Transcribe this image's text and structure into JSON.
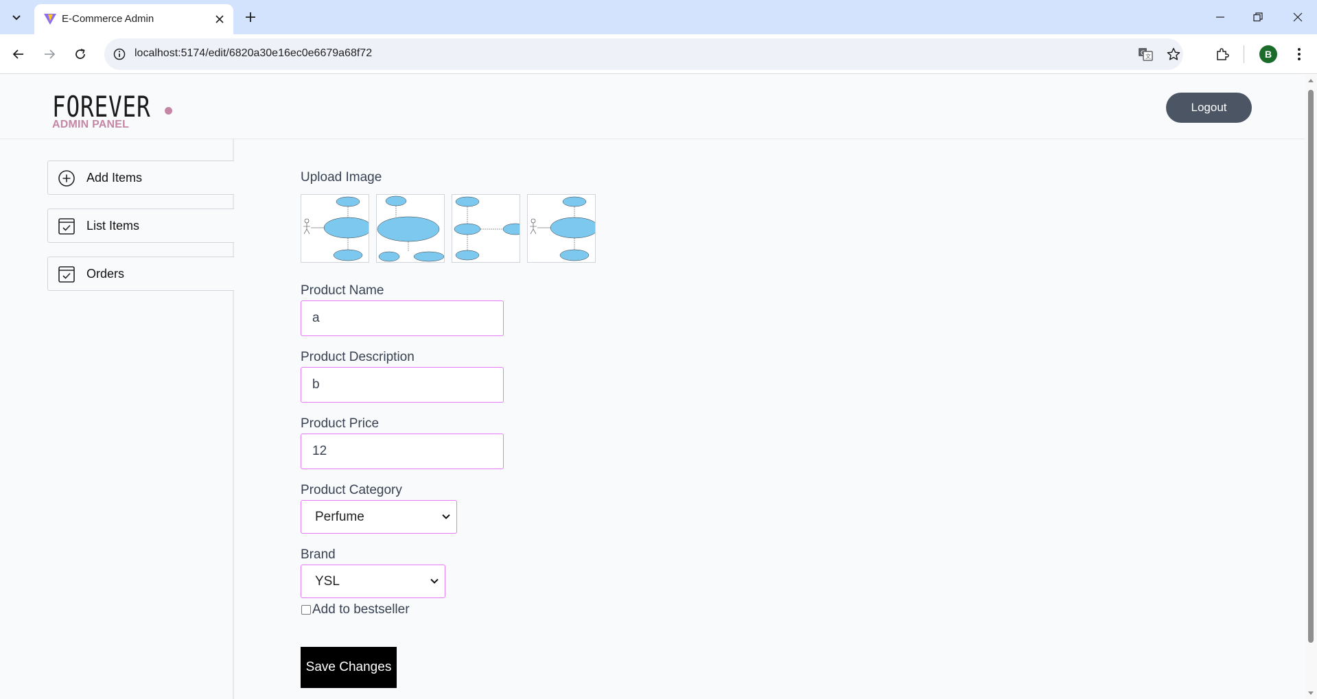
{
  "browser": {
    "tab_title": "E-Commerce Admin",
    "url": "localhost:5174/edit/6820a30e16ec0e6679a68f72",
    "profile_initial": "B"
  },
  "header": {
    "logo_text": "FOREVER",
    "logo_subtitle": "ADMIN PANEL",
    "logout_label": "Logout"
  },
  "sidebar": {
    "items": [
      {
        "label": "Add Items",
        "icon": "add-circle-icon"
      },
      {
        "label": "List Items",
        "icon": "checkbox-icon"
      },
      {
        "label": "Orders",
        "icon": "checkbox-icon"
      }
    ]
  },
  "form": {
    "upload_label": "Upload Image",
    "name_label": "Product Name",
    "name_value": "a",
    "description_label": "Product Description",
    "description_value": "b",
    "price_label": "Product Price",
    "price_value": "12",
    "category_label": "Product Category",
    "category_value": "Perfume",
    "brand_label": "Brand",
    "brand_value": "YSL",
    "bestseller_label": "Add to bestseller",
    "bestseller_checked": false,
    "save_label": "Save Changes"
  },
  "colors": {
    "accent_pink": "#c586a5",
    "input_border": "#e879f9",
    "logout_bg": "#4b5563",
    "tab_strip": "#d3e3fd"
  }
}
